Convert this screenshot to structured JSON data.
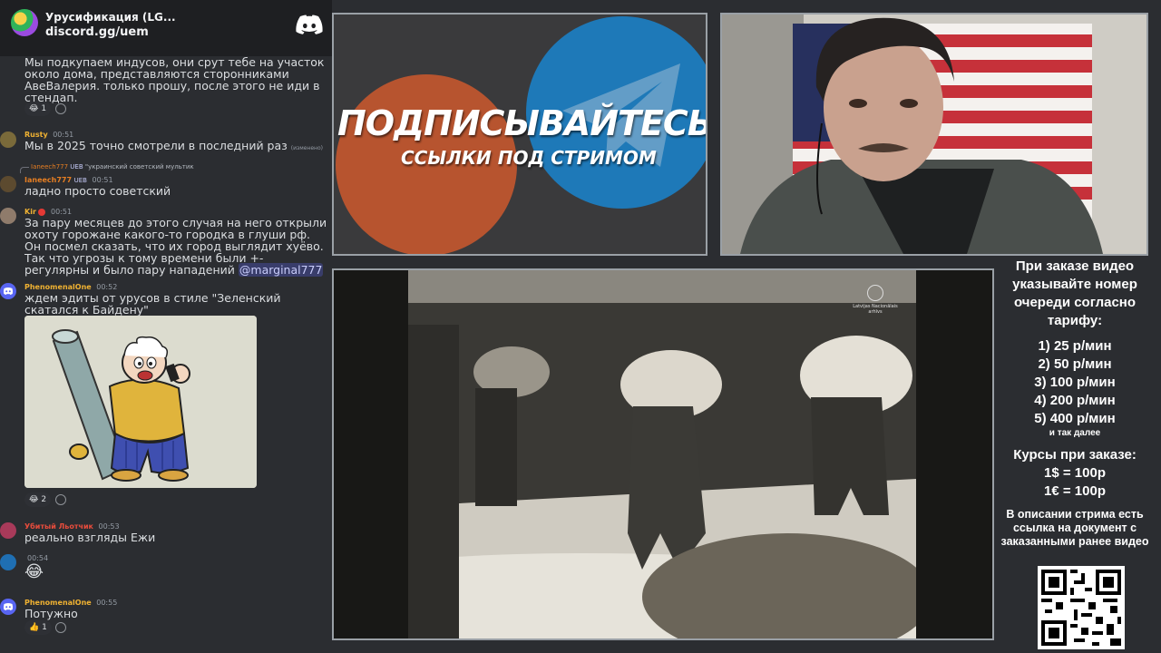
{
  "server": {
    "name": "Урусификация (LG...",
    "invite": "discord.gg/uem",
    "icon": "server-icon",
    "logo": "discord-logo-icon"
  },
  "messages": [
    {
      "id": "m0",
      "text": "Мы подкупаем индусов, они срут тебе на участок около дома, представляются сторонниками АвеВалерия. только прошу, после этого не иди в стендап.",
      "reaction": {
        "emoji": "😂",
        "count": "1"
      }
    },
    {
      "id": "m1",
      "author": "Rusty",
      "author_color": "#f0b232",
      "time": "00:51",
      "text": "Мы в 2025 точно смотрели в последний раз",
      "edited": "(изменено)"
    },
    {
      "id": "m2",
      "reply": {
        "author": "Ianeech777",
        "badge": "UEB",
        "text": "\"украинский советский мультик"
      },
      "author": "Ianeech777",
      "badge": "UEB",
      "author_color": "#e67e22",
      "time": "00:51",
      "text": "ладно просто советский"
    },
    {
      "id": "m3",
      "author": "Kir",
      "author_color": "#f0b232",
      "time": "00:51",
      "text": "За пару месяцев до этого случая на него открыли охоту горожане какого-то городка в глуши рф. Он посмел сказать, что их город выглядит хуёво. Так что угрозы к тому времени были +- регулярны и было пару нападений",
      "mention": "@marginal777"
    },
    {
      "id": "m4",
      "author": "PhenomenalOne",
      "author_color": "#f0b232",
      "time": "00:52",
      "text": "ждем эдиты от урусов в стиле \"Зеленский скатался к Байдену\"",
      "reaction": {
        "emoji": "😂",
        "count": "2"
      }
    },
    {
      "id": "m5",
      "author": "Убитый Льотчик",
      "author_color": "#e74c3c",
      "time": "00:53",
      "text": "реально взгляды Ежи"
    },
    {
      "id": "m6",
      "author": "",
      "time": "00:54",
      "text": "😂"
    },
    {
      "id": "m7",
      "author": "PhenomenalOne",
      "author_color": "#f0b232",
      "time": "00:55",
      "text": "Потужно",
      "reaction": {
        "emoji": "👍",
        "count": "1"
      }
    }
  ],
  "banner": {
    "title": "ПОДПИСЫВАЙТЕСЬ",
    "subtitle": "ССЫЛКИ ПОД СТРИМОМ"
  },
  "video": {
    "watermark": "Latvijas Nacionālais arhīvs"
  },
  "info": {
    "intro": "При заказе видео указывайте номер очереди согласно тарифу:",
    "tariffs": [
      "1) 25 р/мин",
      "2) 50 р/мин",
      "3) 100 р/мин",
      "4) 200 р/мин",
      "5) 400 р/мин"
    ],
    "tariffs_more": "и так далее",
    "rates_title": "Курсы при заказе:",
    "rates": [
      "1$ = 100р",
      "1€ = 100р"
    ],
    "description": "В описании стрима есть ссылка на документ с заказанными ранее видео"
  },
  "colors": {
    "chat_bg": "#2b2d31",
    "blurple": "#5865f2",
    "mention": "#c9cdfb"
  }
}
